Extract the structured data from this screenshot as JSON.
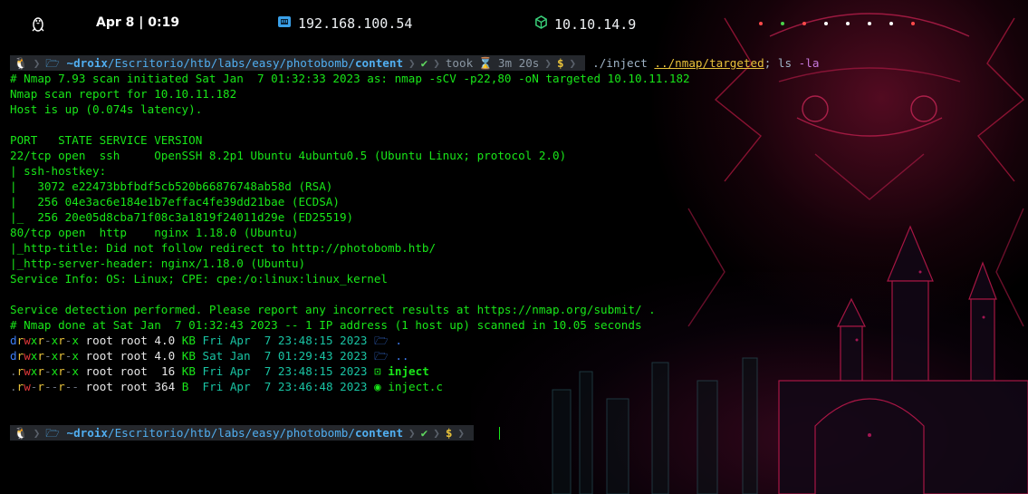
{
  "topbar": {
    "date": "Apr 8 | 0:19",
    "ip_local": "192.168.100.54",
    "ip_vpn": "10.10.14.9",
    "icons": [
      "linux-icon",
      "ethernet-icon",
      "vpn-cube-icon"
    ],
    "workspace_dot_colors": [
      "#ff4a4a",
      "#4ad44a",
      "#ff4a4a",
      "#ffffff",
      "#ffffff",
      "#ffffff",
      "#ffffff",
      "#ff4a4a"
    ]
  },
  "prompt1": {
    "user": "~droix",
    "path": "/Escritorio/htb/labs/easy/photobomb/",
    "dir": "content",
    "status": "✔",
    "took_label": "took",
    "took_value": "3m 20s",
    "dollar": "$",
    "command": "./inject",
    "arg": "../nmap/targeted",
    "rest": "; ls ",
    "opt": "-la"
  },
  "output": [
    "# Nmap 7.93 scan initiated Sat Jan  7 01:32:33 2023 as: nmap -sCV -p22,80 -oN targeted 10.10.11.182",
    "Nmap scan report for 10.10.11.182",
    "Host is up (0.074s latency).",
    "",
    "PORT   STATE SERVICE VERSION",
    "22/tcp open  ssh     OpenSSH 8.2p1 Ubuntu 4ubuntu0.5 (Ubuntu Linux; protocol 2.0)",
    "| ssh-hostkey: ",
    "|   3072 e22473bbfbdf5cb520b66876748ab58d (RSA)",
    "|   256 04e3ac6e184e1b7effac4fe39dd21bae (ECDSA)",
    "|_  256 20e05d8cba71f08c3a1819f24011d29e (ED25519)",
    "80/tcp open  http    nginx 1.18.0 (Ubuntu)",
    "|_http-title: Did not follow redirect to http://photobomb.htb/",
    "|_http-server-header: nginx/1.18.0 (Ubuntu)",
    "Service Info: OS: Linux; CPE: cpe:/o:linux:linux_kernel",
    "",
    "Service detection performed. Please report any incorrect results at https://nmap.org/submit/ .",
    "# Nmap done at Sat Jan  7 01:32:43 2023 -- 1 IP address (1 host up) scanned in 10.05 seconds"
  ],
  "ls": [
    {
      "type": "d",
      "perms": [
        "r",
        "w",
        "x",
        "r",
        "-",
        "x",
        "r",
        "-",
        "x"
      ],
      "owner": "root",
      "group": "root",
      "size": "4.0",
      "unit": "KB",
      "date": "Fri Apr  7 23:48:15 2023",
      "icon": "folder-open-icon",
      "name": "."
    },
    {
      "type": "d",
      "perms": [
        "r",
        "w",
        "x",
        "r",
        "-",
        "x",
        "r",
        "-",
        "x"
      ],
      "owner": "root",
      "group": "root",
      "size": "4.0",
      "unit": "KB",
      "date": "Sat Jan  7 01:29:43 2023",
      "icon": "folder-open-icon",
      "name": ".."
    },
    {
      "type": ".",
      "perms": [
        "r",
        "w",
        "x",
        "r",
        "-",
        "x",
        "r",
        "-",
        "x"
      ],
      "owner": "root",
      "group": "root",
      "size": " 16",
      "unit": "KB",
      "date": "Fri Apr  7 23:48:15 2023",
      "icon": "terminal-icon",
      "name": "inject"
    },
    {
      "type": ".",
      "perms": [
        "r",
        "w",
        "-",
        "r",
        "-",
        "-",
        "r",
        "-",
        "-"
      ],
      "owner": "root",
      "group": "root",
      "size": "364",
      "unit": "B ",
      "date": "Fri Apr  7 23:46:48 2023",
      "icon": "c-source-icon",
      "name": "inject.c"
    }
  ],
  "prompt2": {
    "user": "~droix",
    "path": "/Escritorio/htb/labs/easy/photobomb/",
    "dir": "content",
    "status": "✔",
    "dollar": "$"
  }
}
